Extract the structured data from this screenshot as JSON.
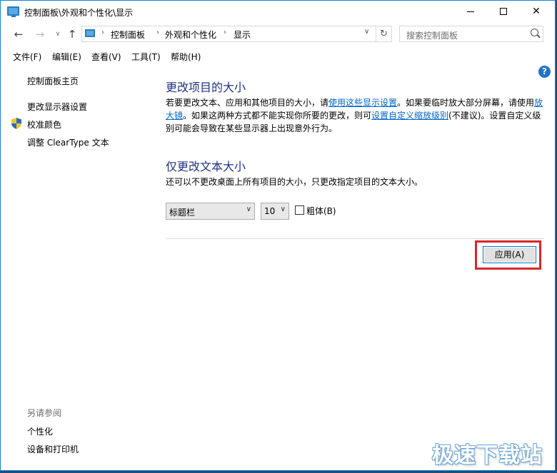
{
  "window": {
    "title": "控制面板\\外观和个性化\\显示",
    "min_icon": "minimize-icon",
    "max_icon": "maximize-icon",
    "close_glyph": "✕"
  },
  "nav": {
    "back": "←",
    "forward": "→",
    "recent": "∨",
    "up": "↑",
    "breadcrumb": [
      "控制面板",
      "外观和个性化",
      "显示"
    ],
    "dropdown": "∨",
    "refresh": "↻",
    "search_placeholder": "搜索控制面板"
  },
  "menu": [
    "文件(F)",
    "编辑(E)",
    "查看(V)",
    "工具(T)",
    "帮助(H)"
  ],
  "sidebar": {
    "home": "控制面板主页",
    "items": [
      "更改显示器设置",
      "校准颜色",
      "调整 ClearType 文本"
    ],
    "see_also_title": "另请参阅",
    "see_also": [
      "个性化",
      "设备和打印机"
    ]
  },
  "main": {
    "heading1": "更改项目的大小",
    "para1": {
      "t1": "若要更改文本、应用和其他项目的大小，请",
      "link1": "使用这些显示设置",
      "t2": "。如果要临时放大部分屏幕，请使用",
      "link2": "放大镜",
      "t3": "。如果这两种方式都不能实现你所要的更改，则可",
      "link3": "设置自定义缩放级别",
      "t4": "(不建议)。设置自定义级别可能会导致在某些显示器上出现意外行为。"
    },
    "heading2": "仅更改文本大小",
    "para2": "还可以不更改桌面上所有项目的大小，只更改指定项目的文本大小。",
    "element_select": "标题栏",
    "size_select": "10",
    "bold_label": "粗体(B)",
    "bold_checked": false,
    "apply_label": "应用(A)",
    "help": "?"
  },
  "watermark": "极速下载站",
  "colors": {
    "heading": "#1e3287",
    "link": "#0066cc",
    "highlight": "#d9262c",
    "window_border": "#1883d7"
  }
}
